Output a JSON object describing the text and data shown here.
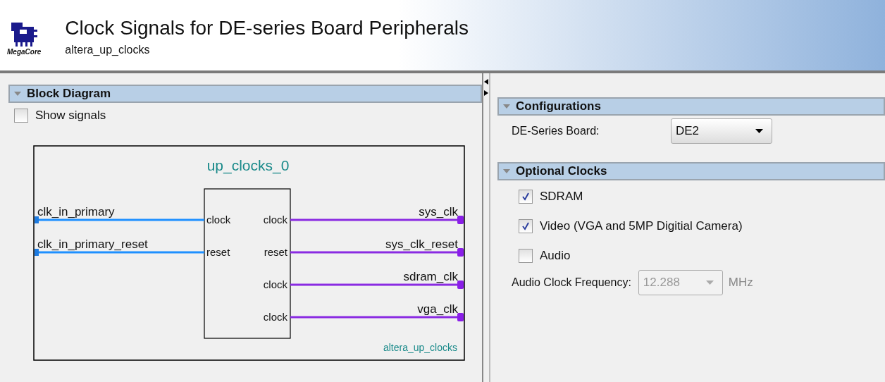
{
  "header": {
    "logo_text": "MegaCore",
    "title": "Clock Signals for DE-series Board Peripherals",
    "subtitle": "altera_up_clocks"
  },
  "block_diagram": {
    "title": "Block Diagram",
    "expanded": true,
    "show_signals": {
      "label": "Show signals",
      "checked": false
    },
    "diagram": {
      "instance": "up_clocks_0",
      "module": "altera_up_clocks",
      "inputs": [
        {
          "name": "clk_in_primary",
          "port": "clock"
        },
        {
          "name": "clk_in_primary_reset",
          "port": "reset"
        }
      ],
      "outputs": [
        {
          "name": "sys_clk",
          "port": "clock"
        },
        {
          "name": "sys_clk_reset",
          "port": "reset"
        },
        {
          "name": "sdram_clk",
          "port": "clock"
        },
        {
          "name": "vga_clk",
          "port": "clock"
        }
      ]
    }
  },
  "configurations": {
    "title": "Configurations",
    "expanded": true,
    "board_label": "DE-Series Board:",
    "board_value": "DE2"
  },
  "optional_clocks": {
    "title": "Optional Clocks",
    "expanded": true,
    "options": [
      {
        "label": "SDRAM",
        "checked": true
      },
      {
        "label": "Video (VGA and 5MP Digitial Camera)",
        "checked": true
      },
      {
        "label": "Audio",
        "checked": false
      }
    ],
    "frequency": {
      "label": "Audio Clock Frequency:",
      "value": "12.288",
      "unit": "MHz",
      "disabled": true
    }
  }
}
